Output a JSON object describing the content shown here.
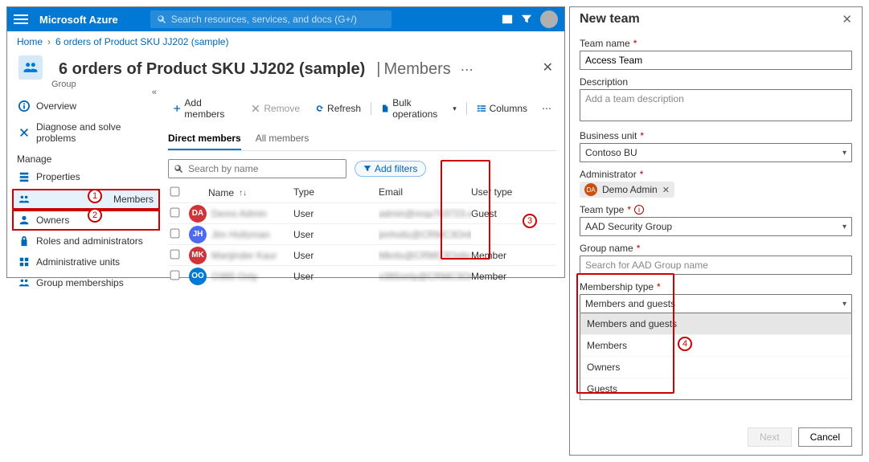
{
  "topbar": {
    "brand": "Microsoft Azure",
    "search_placeholder": "Search resources, services, and docs (G+/)"
  },
  "breadcrumb": {
    "home": "Home",
    "page": "6 orders of Product SKU JJ202 (sample)"
  },
  "header": {
    "title": "6 orders of Product SKU JJ202 (sample)",
    "section": "Members",
    "subtype": "Group"
  },
  "nav": {
    "overview": "Overview",
    "diagnose": "Diagnose and solve problems",
    "manage_header": "Manage",
    "properties": "Properties",
    "members": "Members",
    "owners": "Owners",
    "roles": "Roles and administrators",
    "au": "Administrative units",
    "gm": "Group memberships"
  },
  "cmd": {
    "add": "Add members",
    "remove": "Remove",
    "refresh": "Refresh",
    "bulk": "Bulk operations",
    "columns": "Columns"
  },
  "tabs": {
    "direct": "Direct members",
    "all": "All members"
  },
  "filter": {
    "search_placeholder": "Search by name",
    "add_filters": "Add filters"
  },
  "cols": {
    "name": "Name",
    "type": "Type",
    "email": "Email",
    "usertype": "User type"
  },
  "rows": [
    {
      "initials": "DA",
      "color": "#d13438",
      "name": "Demo Admin",
      "type": "User",
      "email": "admin@msp763723.o…",
      "usertype": "Guest"
    },
    {
      "initials": "JH",
      "color": "#4f6bed",
      "name": "Jim Holtzman",
      "type": "User",
      "email": "jimholtz@CRMC3Onli…",
      "usertype": ""
    },
    {
      "initials": "MK",
      "color": "#d13438",
      "name": "Manjinder Kaur",
      "type": "User",
      "email": "Mkrits@CRMC3Onlin…",
      "usertype": "Member"
    },
    {
      "initials": "OO",
      "color": "#0078d4",
      "name": "O365 Only",
      "type": "User",
      "email": "o365only@CRMC3Onl…",
      "usertype": "Member"
    }
  ],
  "dialog": {
    "title": "New team",
    "team_name_label": "Team name",
    "team_name_value": "Access Team",
    "description_label": "Description",
    "description_placeholder": "Add a team description",
    "bu_label": "Business unit",
    "bu_value": "Contoso BU",
    "admin_label": "Administrator",
    "admin_initials": "DA",
    "admin_name": "Demo Admin",
    "team_type_label": "Team type",
    "team_type_value": "AAD Security Group",
    "group_name_label": "Group name",
    "group_name_placeholder": "Search for AAD Group name",
    "membership_label": "Membership type",
    "membership_value": "Members and guests",
    "membership_options": [
      "Members and guests",
      "Members",
      "Owners",
      "Guests"
    ],
    "next": "Next",
    "cancel": "Cancel"
  },
  "annotations": {
    "1": "1",
    "2": "2",
    "3": "3",
    "4": "4"
  }
}
